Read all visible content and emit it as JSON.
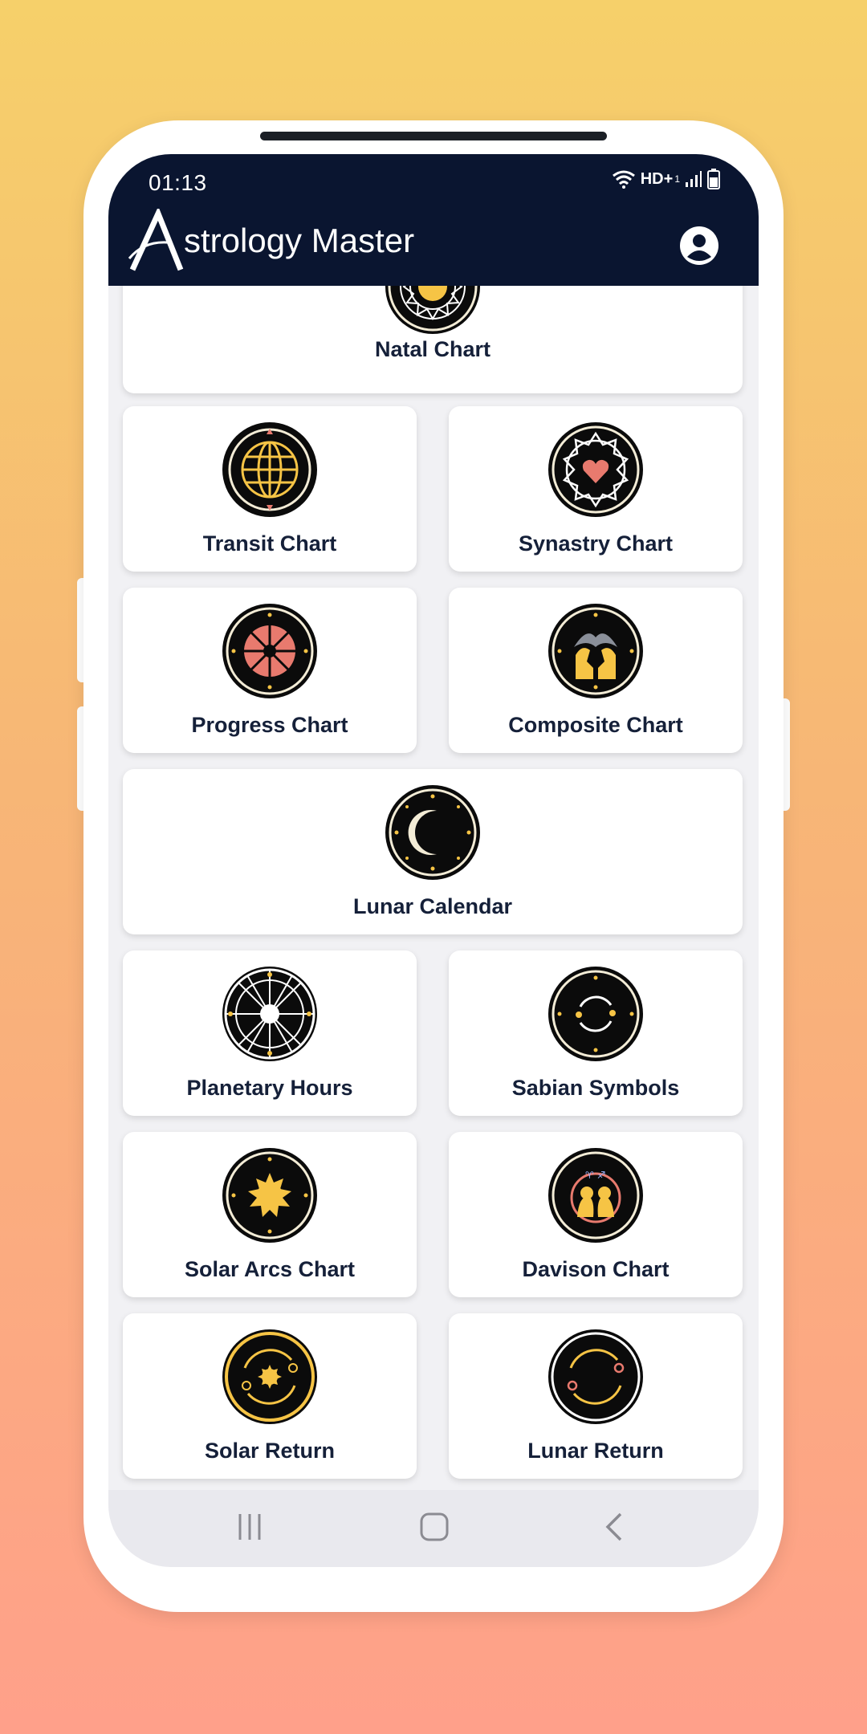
{
  "status_bar": {
    "time": "01:13",
    "network": "HD+",
    "network_sub": "1"
  },
  "app_bar": {
    "title": "strology Master",
    "logo_letter": "A"
  },
  "cards": {
    "natal": "Natal Chart",
    "transit": "Transit Chart",
    "synastry": "Synastry Chart",
    "progress": "Progress Chart",
    "composite": "Composite Chart",
    "lunar_calendar": "Lunar Calendar",
    "planetary_hours": "Planetary Hours",
    "sabian": "Sabian Symbols",
    "solar_arcs": "Solar Arcs Chart",
    "davison": "Davison Chart",
    "solar_return": "Solar Return",
    "lunar_return": "Lunar Return"
  },
  "colors": {
    "navy": "#0a1530",
    "gold": "#f6c445",
    "coral": "#e87a6e",
    "cream": "#f3ecd6"
  },
  "icons": {
    "profile": "account-circle-icon",
    "nav_recent": "recent-apps-icon",
    "nav_home": "home-icon",
    "nav_back": "back-icon"
  }
}
